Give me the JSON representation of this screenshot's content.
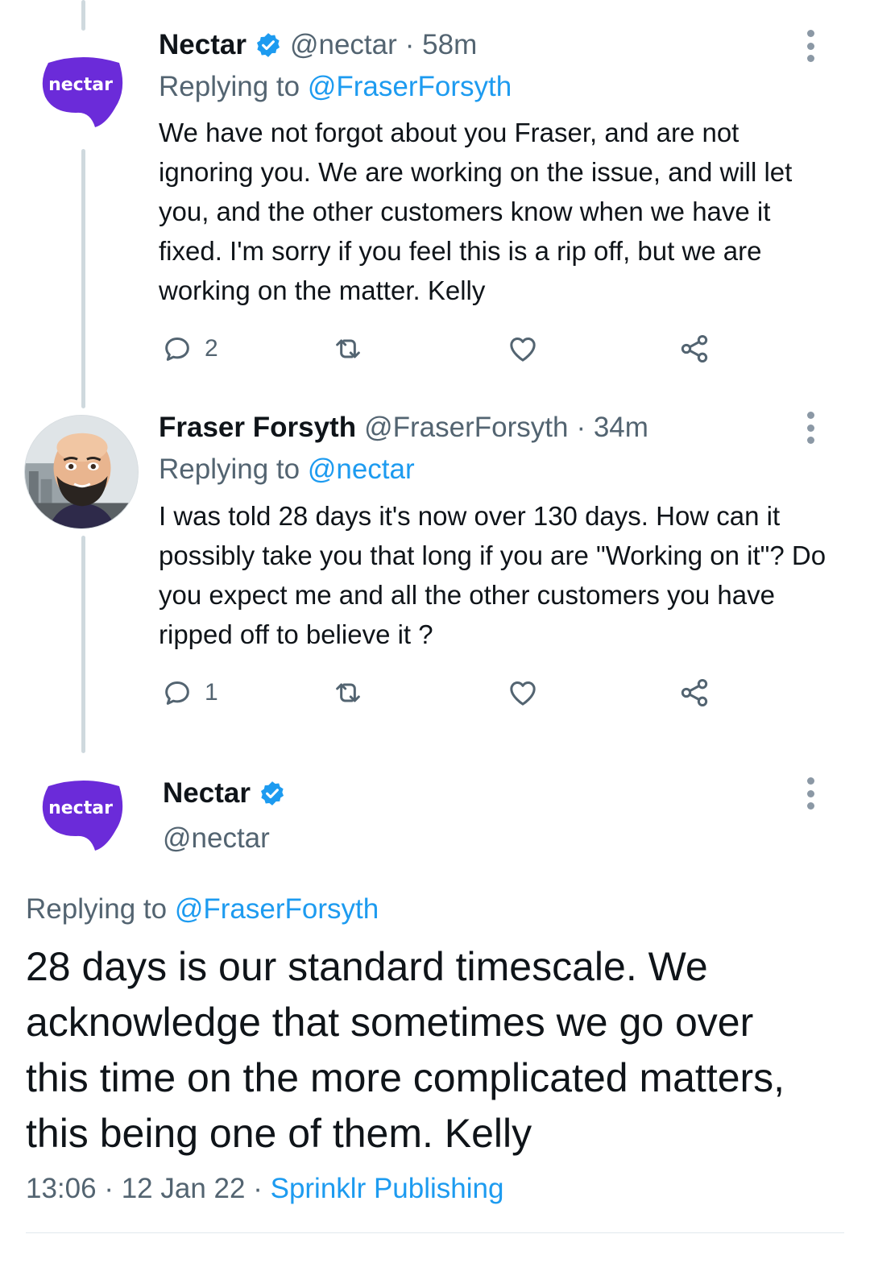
{
  "tweets": [
    {
      "name": "Nectar",
      "handle": "@nectar",
      "time": "· 58m",
      "avatar_text": "nectar",
      "replying_prefix": "Replying to",
      "replying_to": "@FraserForsyth",
      "body": "We have not forgot about you Fraser, and are not ignoring you. We are working on the issue, and  will let you, and the other customers know when we have it fixed. I'm sorry if you feel this is a rip off, but we are working on the matter. Kelly",
      "reply_count": "2",
      "verified": true
    },
    {
      "name": "Fraser Forsyth",
      "handle": "@FraserForsyth",
      "time": "· 34m",
      "replying_prefix": "Replying to",
      "replying_to": "@nectar",
      "body": "I was told 28 days it's now over 130 days. How can it possibly take you that long if you are \"Working on it\"? Do you expect me and all the other customers you have ripped off to believe it ?",
      "reply_count": "1",
      "verified": false
    }
  ],
  "main_tweet": {
    "name": "Nectar",
    "handle": "@nectar",
    "avatar_text": "nectar",
    "replying_prefix": "Replying to",
    "replying_to": "@FraserForsyth",
    "body": "28 days is our standard timescale. We acknowledge that sometimes we go over this time on the more complicated matters, this being one of them. Kelly",
    "time": "13:06",
    "date": "12 Jan 22",
    "source": "Sprinklr Publishing",
    "verified": true
  },
  "colors": {
    "link": "#1d9bf0",
    "secondary_text": "#536471",
    "nectar_purple": "#6b2bd9",
    "thread_line": "#cfd9de"
  },
  "icons": [
    "verified-badge-icon",
    "reply-icon",
    "retweet-icon",
    "like-icon",
    "share-icon",
    "more-options-icon"
  ]
}
